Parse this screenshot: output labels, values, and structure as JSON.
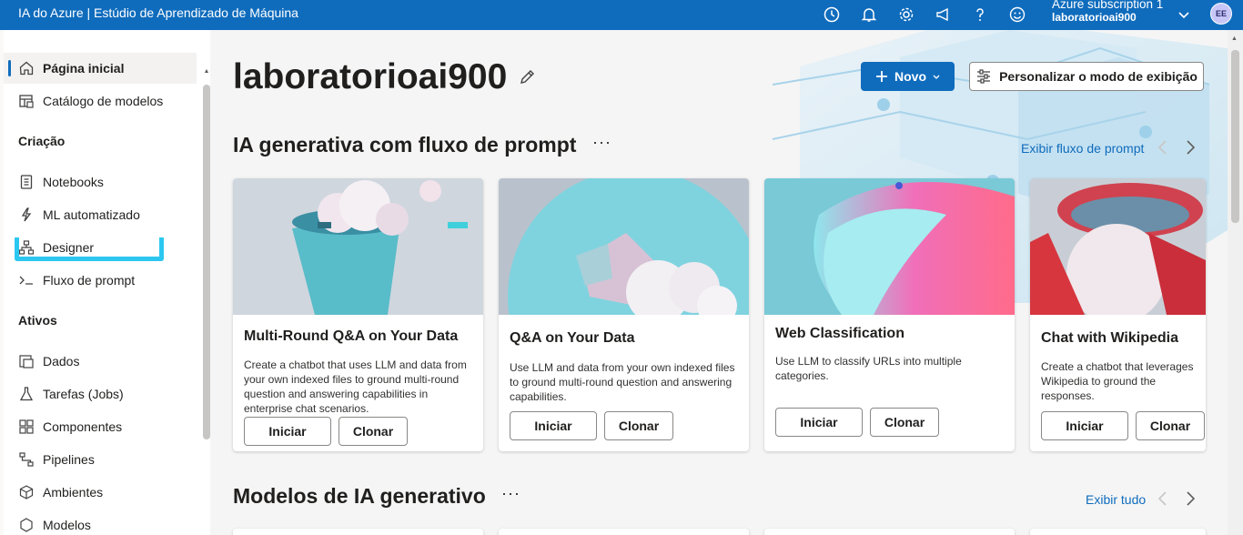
{
  "topbar": {
    "title": "IA do Azure | Estúdio de Aprendizado de Máquina",
    "subscription": "Azure subscription 1",
    "workspace": "laboratorioai900",
    "avatar_initials": "EE",
    "icons": [
      "clock-icon",
      "bell-icon",
      "gear-icon",
      "megaphone-icon",
      "help-icon",
      "smiley-icon",
      "chevron-down-icon"
    ]
  },
  "sidebar": {
    "items_top": [
      {
        "label": "Página inicial",
        "icon": "home-icon",
        "active": true
      },
      {
        "label": "Catálogo de modelos",
        "icon": "catalog-icon"
      }
    ],
    "section_creation": "Criação",
    "items_creation": [
      {
        "label": "Notebooks",
        "icon": "notebook-icon"
      },
      {
        "label": "ML automatizado",
        "icon": "automl-icon"
      },
      {
        "label": "Designer",
        "icon": "designer-icon"
      },
      {
        "label": "Fluxo de prompt",
        "icon": "prompt-icon"
      }
    ],
    "section_assets": "Ativos",
    "items_assets": [
      {
        "label": "Dados",
        "icon": "data-icon"
      },
      {
        "label": "Tarefas (Jobs)",
        "icon": "flask-icon"
      },
      {
        "label": "Componentes",
        "icon": "components-icon"
      },
      {
        "label": "Pipelines",
        "icon": "pipeline-icon"
      },
      {
        "label": "Ambientes",
        "icon": "environment-icon"
      },
      {
        "label": "Modelos",
        "icon": "model-icon"
      }
    ]
  },
  "main": {
    "workspace_title": "laboratorioai900",
    "new_button": "Novo",
    "customize_button": "Personalizar o modo de exibição",
    "section1": {
      "title": "IA generativa com fluxo de prompt",
      "more": "···",
      "link": "Exibir fluxo de prompt"
    },
    "cards": [
      {
        "title": "Multi-Round Q&A on Your Data",
        "desc": "Create a chatbot that uses LLM and data from your own indexed files to ground multi-round question and answering capabilities in enterprise chat scenarios.",
        "start": "Iniciar",
        "clone": "Clonar"
      },
      {
        "title": "Q&A on Your Data",
        "desc": "Use LLM and data from your own indexed files to ground multi-round question and answering capabilities.",
        "start": "Iniciar",
        "clone": "Clonar"
      },
      {
        "title": "Web Classification",
        "desc": "Use LLM to classify URLs into multiple categories.",
        "start": "Iniciar",
        "clone": "Clonar"
      },
      {
        "title": "Chat with Wikipedia",
        "desc": "Create a chatbot that leverages Wikipedia to ground the responses.",
        "start": "Iniciar",
        "clone": "Clonar"
      }
    ],
    "section2": {
      "title": "Modelos de IA generativo",
      "more": "···",
      "link": "Exibir tudo"
    }
  },
  "colors": {
    "brand": "#0f6cbd",
    "highlight": "#2cc7f0"
  }
}
